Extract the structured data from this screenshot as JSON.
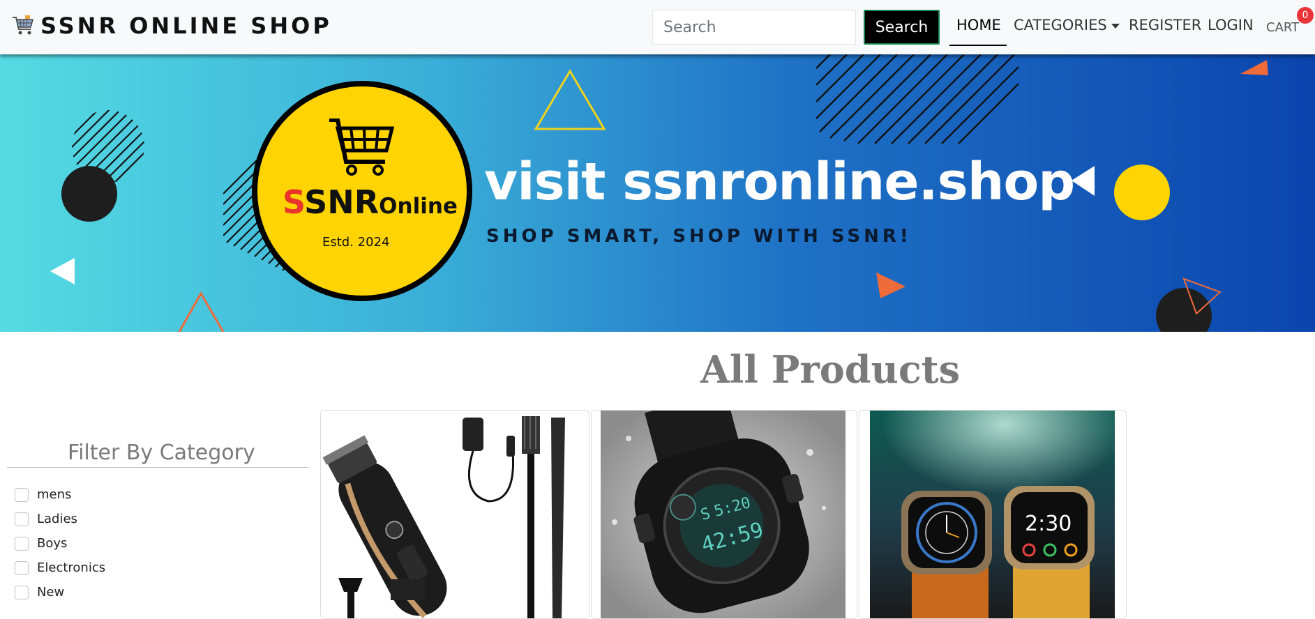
{
  "brand": {
    "name": "SSNR ONLINE SHOP",
    "icon": "shopping-cart-icon"
  },
  "search": {
    "placeholder": "Search",
    "button_label": "Search"
  },
  "nav": {
    "home": "HOME",
    "categories": "CATEGORIES",
    "register": "REGISTER",
    "login": "LOGIN",
    "cart": "CART",
    "cart_count": "0"
  },
  "banner": {
    "logo_s": "S",
    "logo_rest": "SNR",
    "logo_online": "Online",
    "logo_estd": "Estd. 2024",
    "title": "visit ssnronline.shop",
    "subtitle": "SHOP SMART, SHOP WITH SSNR!"
  },
  "main": {
    "heading": "All Products"
  },
  "filter": {
    "title": "Filter By Category",
    "categories": [
      "mens",
      "Ladies",
      "Boys",
      "Electronics",
      "New"
    ]
  },
  "products": [
    {
      "image": "hair-clipper-kit-image"
    },
    {
      "image": "sport-watch-image"
    },
    {
      "image": "smartwatches-image"
    }
  ],
  "colors": {
    "banner_start": "#55dbe3",
    "banner_end": "#0a45ae",
    "logo_yellow": "#ffd400",
    "accent_orange": "#ef6b3a",
    "badge_red": "#e9343a",
    "search_border": "#198754"
  }
}
